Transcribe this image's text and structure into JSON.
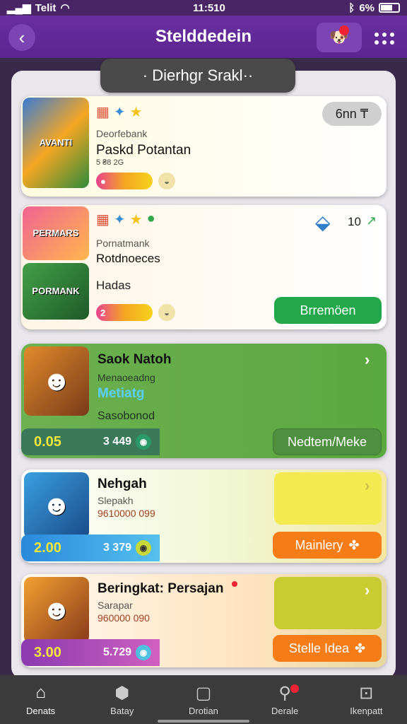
{
  "status": {
    "carrier": "Telit",
    "time": "11:510",
    "battery": "6%"
  },
  "header": {
    "title": "Stelddedein"
  },
  "section": {
    "title": "· Dierhgr Srakl··"
  },
  "cards": [
    {
      "thumb_text": "AVANTI",
      "subtitle": "Deorfebank",
      "title": "Paskd Potantan",
      "meta": "5  ₴8 2G",
      "badge": "6nn ₸",
      "icons": [
        "▦",
        "✦",
        "★"
      ]
    },
    {
      "thumb_text": "PERMARS",
      "thumb2_text": "PORMANK",
      "subtitle": "Pornatmank",
      "title": "Rotdnoeces",
      "meta": "Hadas",
      "badge_value": "10",
      "button": "Brremöen",
      "icons": [
        "▦",
        "✦",
        "★",
        "●"
      ],
      "bar_value": "2"
    },
    {
      "title": "Saok Natoh",
      "subtitle": "Menaoeadng",
      "highlight": "Metiatg",
      "meta": "Sasobonod",
      "score_big": "0.05",
      "score_mid": "3 449",
      "button": "Nedtem/Meke"
    },
    {
      "title": "Nehgah",
      "subtitle": "Slepakh",
      "meta": "9610000 099",
      "score_big": "2.00",
      "score_mid": "3 379",
      "button": "Mainlery"
    },
    {
      "title": "Beringkat: Persajan",
      "subtitle": "Sarapar",
      "meta": "960000 090",
      "score_big": "3.00",
      "score_mid": "5.729",
      "button": "Stelle Idea"
    }
  ],
  "nav": [
    {
      "label": "Denats",
      "icon": "home-icon"
    },
    {
      "label": "Batay",
      "icon": "cube-icon"
    },
    {
      "label": "Drotian",
      "icon": "screen-icon"
    },
    {
      "label": "Derale",
      "icon": "search-icon"
    },
    {
      "label": "Ikenpatt",
      "icon": "lock-icon"
    }
  ],
  "colors": {
    "accent": "#6a2fa0",
    "green": "#22a84a",
    "orange": "#f57c16"
  }
}
